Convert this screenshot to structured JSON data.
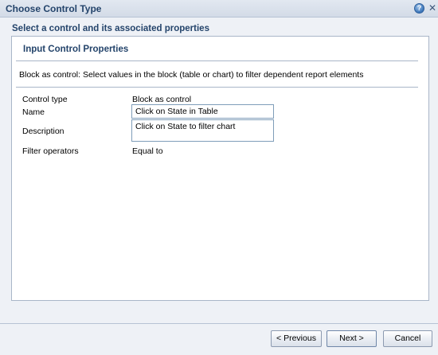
{
  "window": {
    "title": "Choose Control Type",
    "help_glyph": "?",
    "close_glyph": "✕"
  },
  "subtitle": "Select a control and its associated properties",
  "panel": {
    "heading": "Input Control Properties",
    "instruction": "Block as control: Select values in the block (table or chart) to filter dependent report elements"
  },
  "properties": {
    "control_type_label": "Control type",
    "control_type_value": "Block as control",
    "name_label": "Name",
    "name_value": "Click on State in Table",
    "description_label": "Description",
    "description_value": "Click on State to filter chart",
    "filter_operators_label": "Filter operators",
    "filter_operators_value": "Equal to"
  },
  "buttons": {
    "previous": "< Previous",
    "next": "Next >",
    "cancel": "Cancel"
  },
  "icons": {
    "help": "help-icon",
    "close": "close-icon"
  }
}
